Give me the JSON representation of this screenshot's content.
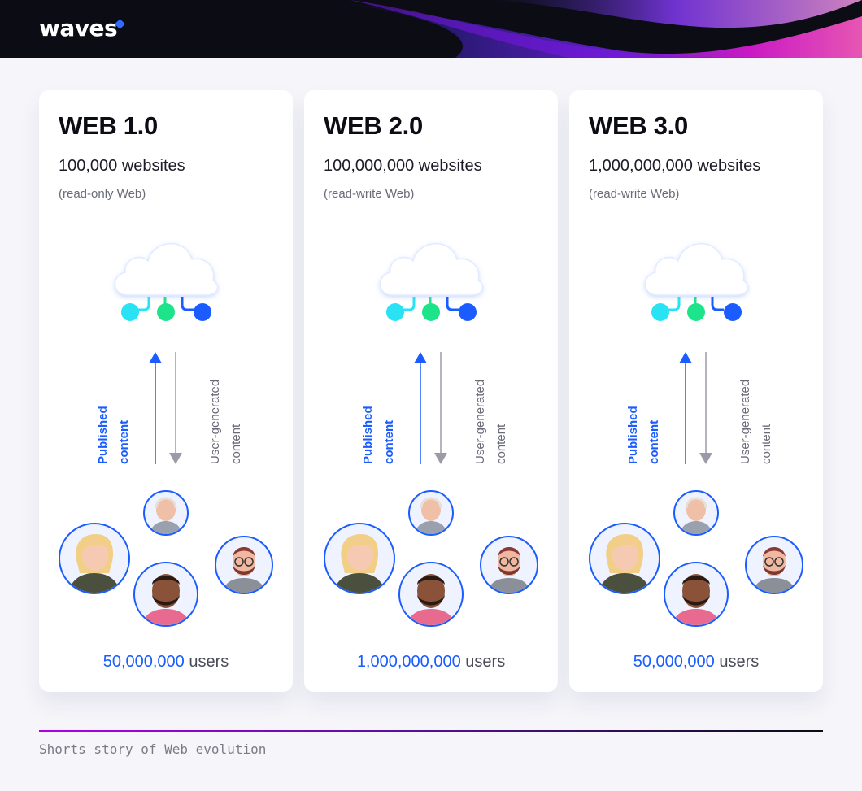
{
  "header": {
    "logo_text": "waves"
  },
  "colors": {
    "accent_blue": "#1a5cff",
    "cyan": "#29e3f5",
    "green": "#1de48a",
    "header_bg": "#0b0c14",
    "footer_gradient_start": "#b000e6"
  },
  "cards": [
    {
      "title": "WEB 1.0",
      "count": "100,000 websites",
      "note": "(read-only Web)",
      "published_line1": "Published",
      "published_line2": "content",
      "ugc_line1": "User-generated",
      "ugc_line2": "content",
      "users_number": "50,000,000",
      "users_word": "users"
    },
    {
      "title": "WEB 2.0",
      "count": "100,000,000 websites",
      "note": "(read-write Web)",
      "published_line1": "Published",
      "published_line2": "content",
      "ugc_line1": "User-generated",
      "ugc_line2": "content",
      "users_number": "1,000,000,000",
      "users_word": "users"
    },
    {
      "title": "WEB 3.0",
      "count": "1,000,000,000 websites",
      "note": "(read-write Web)",
      "published_line1": "Published",
      "published_line2": "content",
      "ugc_line1": "User-generated",
      "ugc_line2": "content",
      "users_number": "50,000,000",
      "users_word": "users"
    }
  ],
  "footer": {
    "caption": "Shorts story of Web evolution"
  }
}
